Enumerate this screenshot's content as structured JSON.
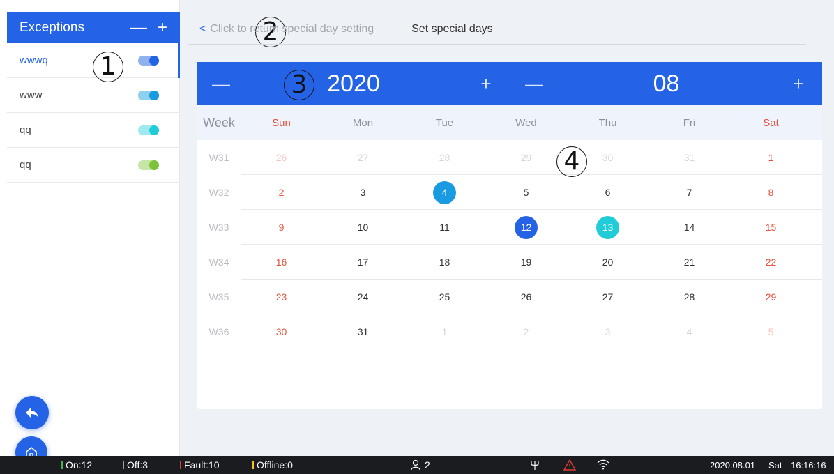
{
  "sidebar": {
    "title": "Exceptions",
    "minus_label": "—",
    "plus_label": "+",
    "items": [
      {
        "name": "wwwq",
        "toggle_track": "#8fb1ee",
        "toggle_knob": "#2462e6"
      },
      {
        "name": "www",
        "toggle_track": "#8ed0ee",
        "toggle_knob": "#1a9ae0"
      },
      {
        "name": "qq",
        "toggle_track": "#9fe9ef",
        "toggle_knob": "#21ccd9"
      },
      {
        "name": "qq",
        "toggle_track": "#c6e6a7",
        "toggle_knob": "#7cc33b"
      }
    ]
  },
  "callouts": {
    "c1": "1",
    "c2": "2",
    "c3": "3",
    "c4": "4"
  },
  "topbar": {
    "back_chevron": "<",
    "back_label": "Click to return special day setting",
    "title": "Set special days"
  },
  "calendar": {
    "year": "2020",
    "month": "08",
    "minus_label": "—",
    "plus_label": "+",
    "week_header": "Week",
    "days": [
      "Sun",
      "Mon",
      "Tue",
      "Wed",
      "Thu",
      "Fri",
      "Sat"
    ],
    "rows": [
      {
        "week": "W31",
        "dates": [
          "26",
          "27",
          "28",
          "29",
          "30",
          "31",
          "1"
        ]
      },
      {
        "week": "W32",
        "dates": [
          "2",
          "3",
          "4",
          "5",
          "6",
          "7",
          "8"
        ]
      },
      {
        "week": "W33",
        "dates": [
          "9",
          "10",
          "11",
          "12",
          "13",
          "14",
          "15"
        ]
      },
      {
        "week": "W34",
        "dates": [
          "16",
          "17",
          "18",
          "19",
          "20",
          "21",
          "22"
        ]
      },
      {
        "week": "W35",
        "dates": [
          "23",
          "24",
          "25",
          "26",
          "27",
          "28",
          "29"
        ]
      },
      {
        "week": "W36",
        "dates": [
          "30",
          "31",
          "1",
          "2",
          "3",
          "4",
          "5"
        ]
      }
    ],
    "highlight_colors": {
      "4": "#1a9ae0",
      "12": "#2462e6",
      "13": "#21ccd9"
    }
  },
  "status_bar": {
    "on": "On:12",
    "off": "Off:3",
    "fault": "Fault:10",
    "offline": "Offline:0",
    "users": "2",
    "date": "2020.08.01",
    "weekday": "Sat",
    "time": "16:16:16",
    "colors": {
      "on": "#4caf50",
      "off": "#9e9e9e",
      "fault": "#e53935",
      "offline": "#f5c518",
      "warning": "#e53935"
    }
  },
  "icons": [
    "back-arrow-icon",
    "home-icon",
    "user-icon",
    "antenna-icon",
    "warning-icon",
    "wifi-icon",
    "chevron-left-icon"
  ]
}
